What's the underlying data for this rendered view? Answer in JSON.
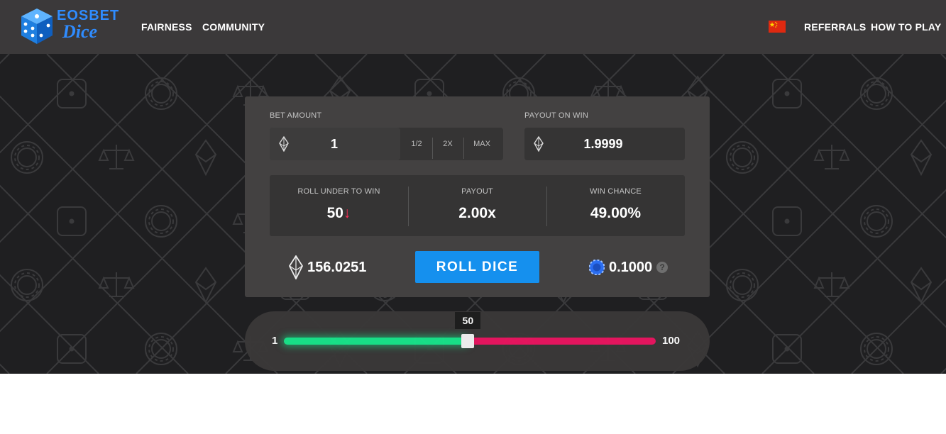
{
  "nav": {
    "logo_line1": "EOSBET",
    "logo_line2": "Dice",
    "links": {
      "fairness": "FAIRNESS",
      "community": "COMMUNITY",
      "referrals": "REFERRALS",
      "how_to_play": "HOW TO PLAY"
    },
    "flag": "china-flag"
  },
  "bet": {
    "label": "BET AMOUNT",
    "value": "1",
    "half": "1/2",
    "double": "2X",
    "max": "MAX",
    "currency_icon": "eos-icon"
  },
  "payout_on_win": {
    "label": "PAYOUT ON WIN",
    "value": "1.9999"
  },
  "stats": {
    "roll_under": {
      "label": "ROLL UNDER TO WIN",
      "value": "50",
      "arrow": "↓"
    },
    "payout": {
      "label": "PAYOUT",
      "value": "2.00x"
    },
    "win_chance": {
      "label": "WIN CHANCE",
      "value": "49.00%"
    }
  },
  "balance": {
    "value": "156.0251",
    "icon": "eos-icon"
  },
  "roll_button": "ROLL DICE",
  "token": {
    "value": "0.1000",
    "icon": "bet-token-icon",
    "help": "?"
  },
  "slider": {
    "min_label": "1",
    "max_label": "100",
    "min": 1,
    "max": 100,
    "value": 50,
    "tooltip": "50"
  },
  "colors": {
    "accent": "#1590ee",
    "win": "#18e48a",
    "lose": "#ea1560",
    "panel": "#434141",
    "nav": "#3b393a"
  }
}
